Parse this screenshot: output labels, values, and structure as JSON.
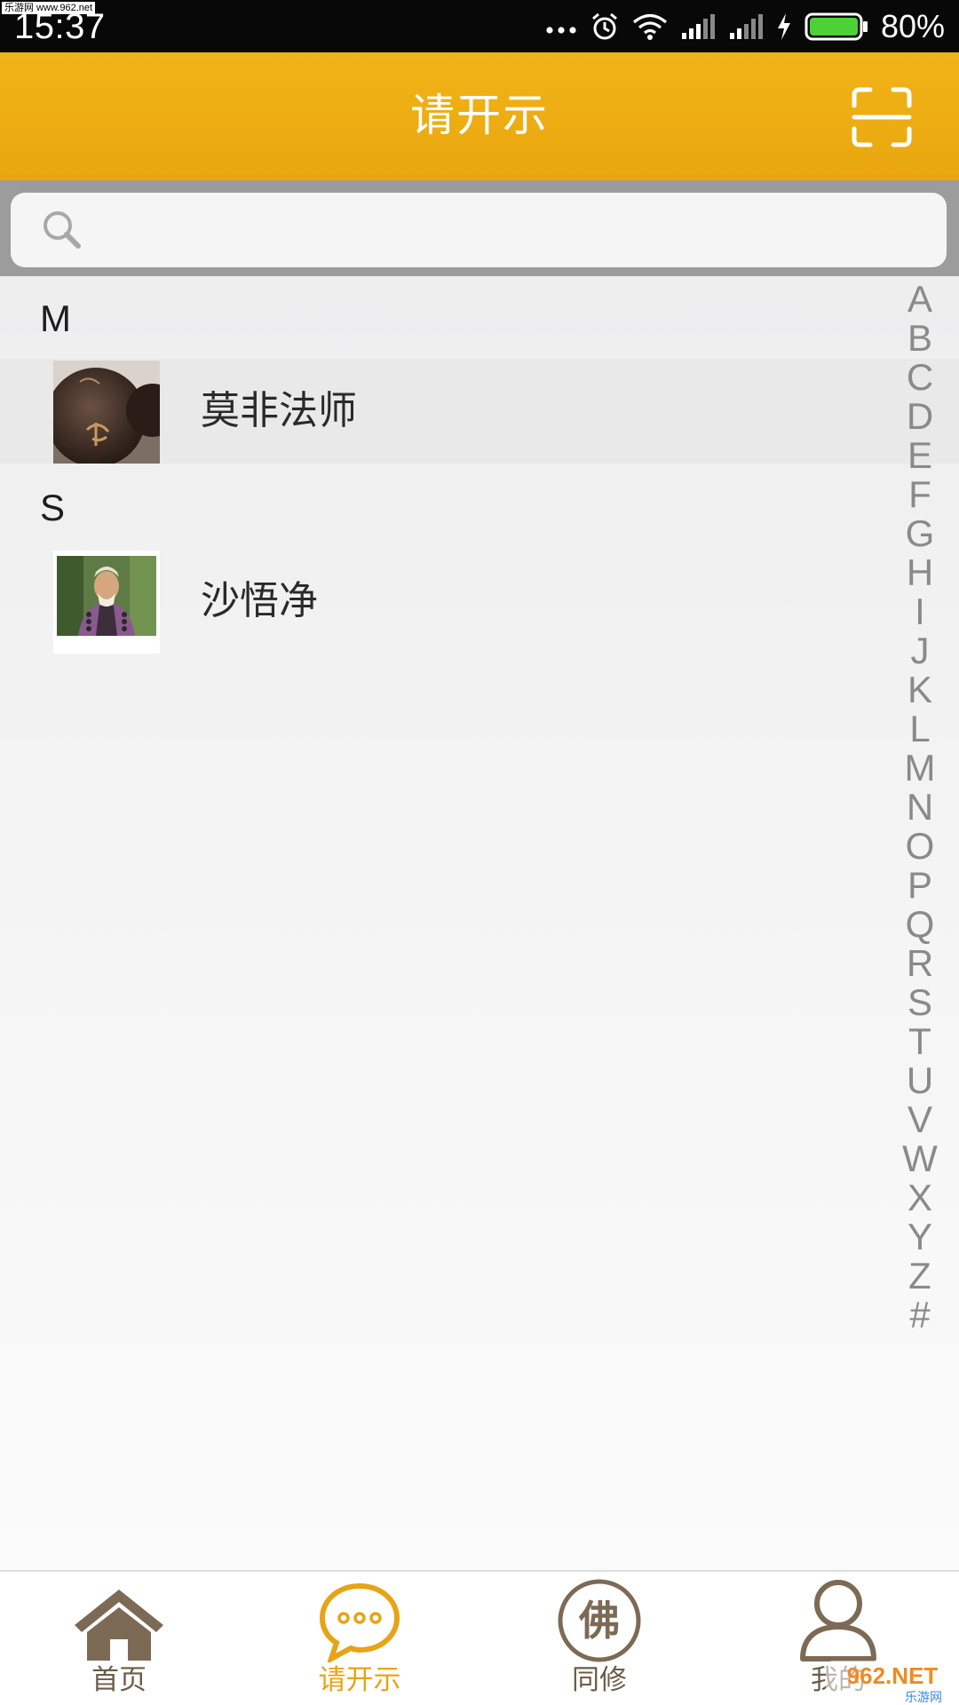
{
  "status_bar": {
    "time": "15:37",
    "watermark": "乐游网 www.962.net",
    "battery_percent": "80%",
    "icons": [
      "more-dots-icon",
      "alarm-icon",
      "wifi-icon",
      "signal-icon",
      "signal-icon-2",
      "charging-icon",
      "battery-icon"
    ],
    "battery_color": "#4cd137"
  },
  "header": {
    "title": "请开示",
    "scan_icon": "scan-icon",
    "background_color": "#eeac12"
  },
  "search": {
    "placeholder": "",
    "value": "",
    "icon": "search-icon"
  },
  "contacts": {
    "sections": [
      {
        "letter": "M",
        "items": [
          {
            "name": "莫非法师",
            "avatar": "prayer-bead-avatar",
            "selected": true
          }
        ]
      },
      {
        "letter": "S",
        "items": [
          {
            "name": "沙悟净",
            "avatar": "person-photo-avatar",
            "selected": false
          }
        ]
      }
    ]
  },
  "alpha_index": [
    "A",
    "B",
    "C",
    "D",
    "E",
    "F",
    "G",
    "H",
    "I",
    "J",
    "K",
    "L",
    "M",
    "N",
    "O",
    "P",
    "Q",
    "R",
    "S",
    "T",
    "U",
    "V",
    "W",
    "X",
    "Y",
    "Z",
    "#"
  ],
  "bottom_nav": {
    "items": [
      {
        "label": "首页",
        "icon": "home-icon",
        "active": false
      },
      {
        "label": "请开示",
        "icon": "chat-bubble-icon",
        "active": true
      },
      {
        "label": "同修",
        "icon": "buddha-icon",
        "active": false
      },
      {
        "label": "我的",
        "icon": "person-icon",
        "active": false
      }
    ],
    "active_color": "#e8a317",
    "inactive_color": "#6c5c48",
    "buddha_glyph": "佛"
  },
  "watermark_bottom": "962.NET 乐游网"
}
